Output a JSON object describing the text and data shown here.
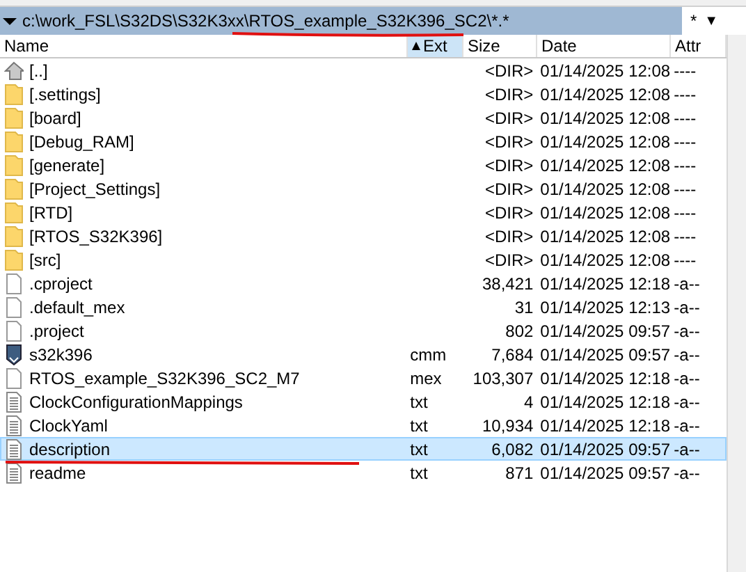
{
  "path_bar": {
    "path": "c:\\work_FSL\\S32DS\\S32K3xx\\RTOS_example_S32K396_SC2\\*.*",
    "filter": "*",
    "dropdown": "▼"
  },
  "columns": [
    {
      "label": "Name",
      "sorted": false
    },
    {
      "label": "Ext",
      "sorted": true
    },
    {
      "label": "Size",
      "sorted": false
    },
    {
      "label": "Date",
      "sorted": false
    },
    {
      "label": "Attr",
      "sorted": false
    }
  ],
  "rows": [
    {
      "kind": "parent",
      "name": "[..]",
      "ext": "",
      "size": "<DIR>",
      "date": "01/14/2025 12:08",
      "attr": "----",
      "selected": false
    },
    {
      "kind": "folder",
      "name": "[.settings]",
      "ext": "",
      "size": "<DIR>",
      "date": "01/14/2025 12:08",
      "attr": "----",
      "selected": false
    },
    {
      "kind": "folder",
      "name": "[board]",
      "ext": "",
      "size": "<DIR>",
      "date": "01/14/2025 12:08",
      "attr": "----",
      "selected": false
    },
    {
      "kind": "folder",
      "name": "[Debug_RAM]",
      "ext": "",
      "size": "<DIR>",
      "date": "01/14/2025 12:08",
      "attr": "----",
      "selected": false
    },
    {
      "kind": "folder",
      "name": "[generate]",
      "ext": "",
      "size": "<DIR>",
      "date": "01/14/2025 12:08",
      "attr": "----",
      "selected": false
    },
    {
      "kind": "folder",
      "name": "[Project_Settings]",
      "ext": "",
      "size": "<DIR>",
      "date": "01/14/2025 12:08",
      "attr": "----",
      "selected": false
    },
    {
      "kind": "folder",
      "name": "[RTD]",
      "ext": "",
      "size": "<DIR>",
      "date": "01/14/2025 12:08",
      "attr": "----",
      "selected": false
    },
    {
      "kind": "folder",
      "name": "[RTOS_S32K396]",
      "ext": "",
      "size": "<DIR>",
      "date": "01/14/2025 12:08",
      "attr": "----",
      "selected": false
    },
    {
      "kind": "folder",
      "name": "[src]",
      "ext": "",
      "size": "<DIR>",
      "date": "01/14/2025 12:08",
      "attr": "----",
      "selected": false
    },
    {
      "kind": "file",
      "name": ".cproject",
      "ext": "",
      "size": "38,421",
      "date": "01/14/2025 12:18",
      "attr": "-a--",
      "selected": false
    },
    {
      "kind": "file",
      "name": ".default_mex",
      "ext": "",
      "size": "31",
      "date": "01/14/2025 12:13",
      "attr": "-a--",
      "selected": false
    },
    {
      "kind": "file",
      "name": ".project",
      "ext": "",
      "size": "802",
      "date": "01/14/2025 09:57",
      "attr": "-a--",
      "selected": false
    },
    {
      "kind": "script",
      "name": "s32k396",
      "ext": "cmm",
      "size": "7,684",
      "date": "01/14/2025 09:57",
      "attr": "-a--",
      "selected": false
    },
    {
      "kind": "file",
      "name": "RTOS_example_S32K396_SC2_M7",
      "ext": "mex",
      "size": "103,307",
      "date": "01/14/2025 12:18",
      "attr": "-a--",
      "selected": false
    },
    {
      "kind": "text",
      "name": "ClockConfigurationMappings",
      "ext": "txt",
      "size": "4",
      "date": "01/14/2025 12:18",
      "attr": "-a--",
      "selected": false
    },
    {
      "kind": "text",
      "name": "ClockYaml",
      "ext": "txt",
      "size": "10,934",
      "date": "01/14/2025 12:18",
      "attr": "-a--",
      "selected": false
    },
    {
      "kind": "text",
      "name": "description",
      "ext": "txt",
      "size": "6,082",
      "date": "01/14/2025 09:57",
      "attr": "-a--",
      "selected": true
    },
    {
      "kind": "text",
      "name": "readme",
      "ext": "txt",
      "size": "871",
      "date": "01/14/2025 09:57",
      "attr": "-a--",
      "selected": false
    }
  ]
}
